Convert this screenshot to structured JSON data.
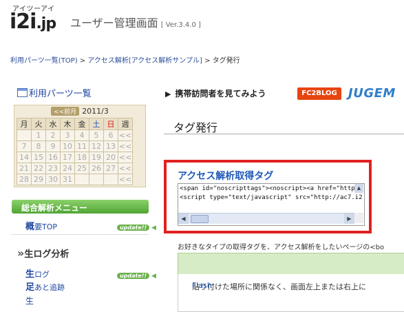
{
  "header": {
    "logo_kana": "アイツーアイ",
    "logo_brand": "i2i",
    "logo_tld": ".jp",
    "title": "ユーザー管理画面",
    "version": "[ Ver.3.4.0 ]"
  },
  "breadcrumb": {
    "items": [
      "利用パーツ一覧(TOP)",
      "アクセス解析[アクセス解析サンプル]"
    ],
    "separator": " > ",
    "current": "タグ発行"
  },
  "sidebar": {
    "parts_list_label": "利用パーツ一覧",
    "calendar": {
      "prev_label": "<<前月",
      "month": "2011/3",
      "weekdays": [
        "月",
        "火",
        "水",
        "木",
        "金",
        "土",
        "日",
        "週"
      ],
      "weeks": [
        [
          "",
          "1",
          "2",
          "3",
          "4",
          "5",
          "6",
          "<<"
        ],
        [
          "7",
          "8",
          "9",
          "10",
          "11",
          "12",
          "13",
          "<<"
        ],
        [
          "14",
          "15",
          "16",
          "17",
          "18",
          "19",
          "20",
          "<<"
        ],
        [
          "21",
          "22",
          "23",
          "24",
          "25",
          "26",
          "27",
          "<<"
        ],
        [
          "28",
          "29",
          "30",
          "31",
          "",
          "",
          "",
          "<<"
        ]
      ]
    },
    "menu_title": "総合解析メニュー",
    "overview_initial": "概",
    "overview_rest": "要TOP",
    "update_badge": "update!!",
    "live_section_mark": "»",
    "live_section_title": "生ログ分析",
    "live_log_initial": "生",
    "live_log_rest": "ログ",
    "footprint_initial": "足",
    "footprint_rest": "あと追跡",
    "more_label": "生"
  },
  "main": {
    "mobile_label": "携帯訪問者を見てみよう",
    "fc2_label": "FC2BLOG",
    "jugem_label": "JUGEM",
    "page_heading": "タグ発行",
    "tag_title": "アクセス解析取得タグ",
    "code_lines": [
      "<span id=\"noscripttags\"><noscript><a href=\"http",
      "<script type=\"text/javascript\" src=\"http://ac7.i2"
    ],
    "instructions": "お好きなタイプの取得タグを、アクセス解析をしたいページの<bo",
    "paste_text": "貼り付けた場所に関係なく、画面左上または右上に",
    "paste_flash": "Flash"
  }
}
